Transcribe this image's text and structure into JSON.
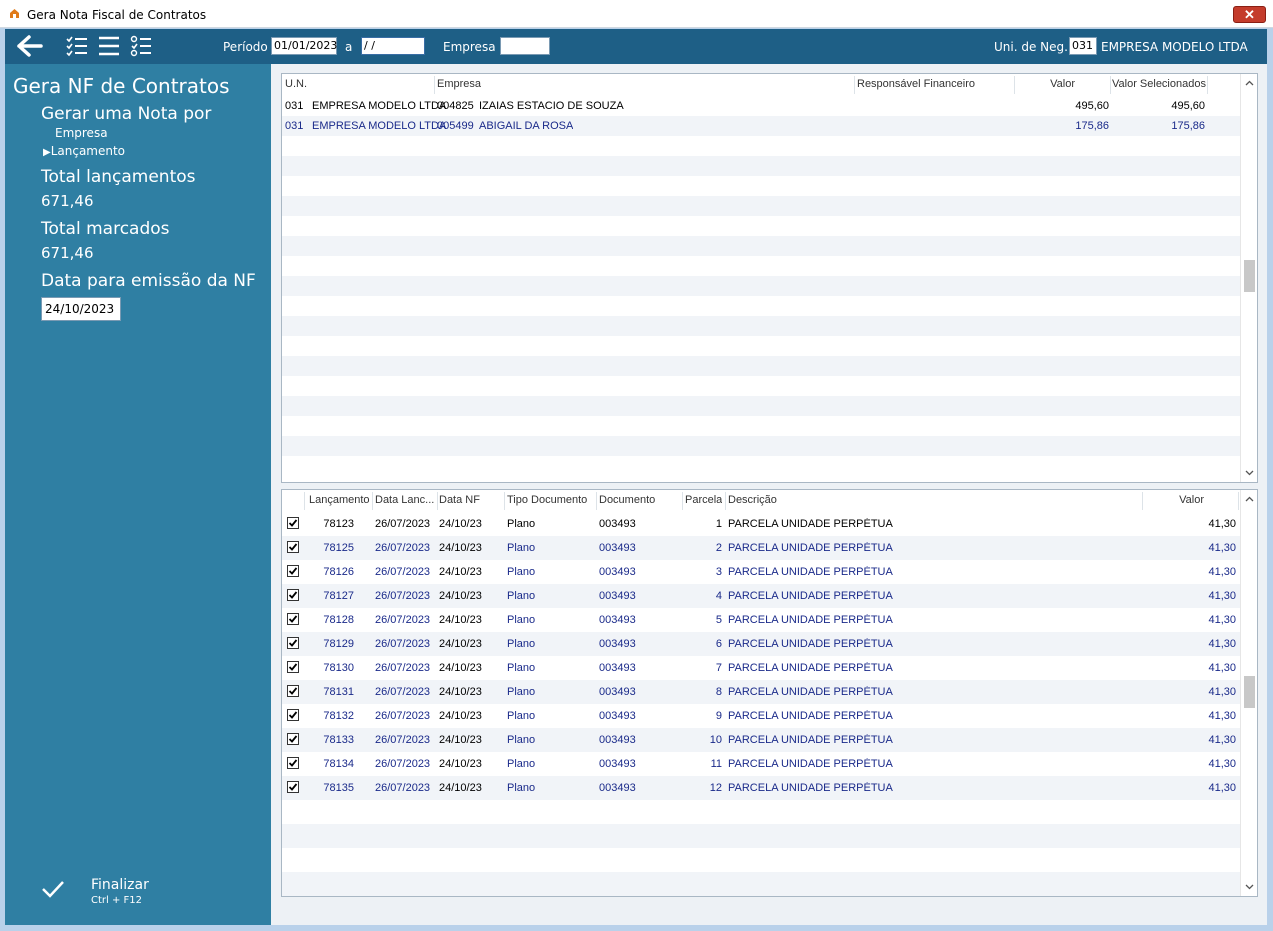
{
  "window": {
    "title": "Gera Nota Fiscal de Contratos",
    "close_glyph": "✕"
  },
  "toolbar": {
    "periodo_label": "Período",
    "periodo_start": "01/01/2023",
    "a_label": "a",
    "periodo_end": " / /",
    "empresa_label": "Empresa",
    "empresa_value": "",
    "uni_label": "Uni. de Neg.",
    "uni_code": "031",
    "uni_name": "EMPRESA MODELO LTDA"
  },
  "sidebar": {
    "heading": "Gera NF de Contratos",
    "gerar_label": "Gerar uma Nota por",
    "option_empresa": "Empresa",
    "option_lancamento": "Lançamento",
    "selected_marker": "▶",
    "total_lanc_label": "Total lançamentos",
    "total_lanc_value": "671,46",
    "total_marc_label": "Total marcados",
    "total_marc_value": "671,46",
    "data_emissao_label": "Data para emissão da NF",
    "data_emissao_value": "24/10/2023",
    "finalizar_label": "Finalizar",
    "finalizar_shortcut": "Ctrl + F12"
  },
  "grid_empresas": {
    "headers": [
      "U.N.",
      "Empresa",
      "Responsável Financeiro",
      "Valor",
      "Valor Selecionados"
    ],
    "rows": [
      {
        "un": "031",
        "un_name": "EMPRESA MODELO LTDA",
        "code": "004825",
        "name": "IZAIAS ESTACIO DE SOUZA",
        "resp": "",
        "valor": "495,60",
        "valor_sel": "495,60"
      },
      {
        "un": "031",
        "un_name": "EMPRESA MODELO LTDA",
        "code": "005499",
        "name": "ABIGAIL DA ROSA",
        "resp": "",
        "valor": "175,86",
        "valor_sel": "175,86"
      }
    ]
  },
  "grid_lancamentos": {
    "headers": [
      "Lançamento",
      "Data Lanc...",
      "Data NF",
      "Tipo Documento",
      "Documento",
      "Parcela",
      "Descrição",
      "Valor"
    ],
    "rows": [
      {
        "checked": true,
        "lanc": "78123",
        "data_lanc": "26/07/2023",
        "data_nf": "24/10/23",
        "tipo": "Plano",
        "doc": "003493",
        "parcela": "1",
        "desc": "PARCELA UNIDADE PERPÉTUA",
        "valor": "41,30"
      },
      {
        "checked": true,
        "lanc": "78125",
        "data_lanc": "26/07/2023",
        "data_nf": "24/10/23",
        "tipo": "Plano",
        "doc": "003493",
        "parcela": "2",
        "desc": "PARCELA UNIDADE PERPÉTUA",
        "valor": "41,30"
      },
      {
        "checked": true,
        "lanc": "78126",
        "data_lanc": "26/07/2023",
        "data_nf": "24/10/23",
        "tipo": "Plano",
        "doc": "003493",
        "parcela": "3",
        "desc": "PARCELA UNIDADE PERPÉTUA",
        "valor": "41,30"
      },
      {
        "checked": true,
        "lanc": "78127",
        "data_lanc": "26/07/2023",
        "data_nf": "24/10/23",
        "tipo": "Plano",
        "doc": "003493",
        "parcela": "4",
        "desc": "PARCELA UNIDADE PERPÉTUA",
        "valor": "41,30"
      },
      {
        "checked": true,
        "lanc": "78128",
        "data_lanc": "26/07/2023",
        "data_nf": "24/10/23",
        "tipo": "Plano",
        "doc": "003493",
        "parcela": "5",
        "desc": "PARCELA UNIDADE PERPÉTUA",
        "valor": "41,30"
      },
      {
        "checked": true,
        "lanc": "78129",
        "data_lanc": "26/07/2023",
        "data_nf": "24/10/23",
        "tipo": "Plano",
        "doc": "003493",
        "parcela": "6",
        "desc": "PARCELA UNIDADE PERPÉTUA",
        "valor": "41,30"
      },
      {
        "checked": true,
        "lanc": "78130",
        "data_lanc": "26/07/2023",
        "data_nf": "24/10/23",
        "tipo": "Plano",
        "doc": "003493",
        "parcela": "7",
        "desc": "PARCELA UNIDADE PERPÉTUA",
        "valor": "41,30"
      },
      {
        "checked": true,
        "lanc": "78131",
        "data_lanc": "26/07/2023",
        "data_nf": "24/10/23",
        "tipo": "Plano",
        "doc": "003493",
        "parcela": "8",
        "desc": "PARCELA UNIDADE PERPÉTUA",
        "valor": "41,30"
      },
      {
        "checked": true,
        "lanc": "78132",
        "data_lanc": "26/07/2023",
        "data_nf": "24/10/23",
        "tipo": "Plano",
        "doc": "003493",
        "parcela": "9",
        "desc": "PARCELA UNIDADE PERPÉTUA",
        "valor": "41,30"
      },
      {
        "checked": true,
        "lanc": "78133",
        "data_lanc": "26/07/2023",
        "data_nf": "24/10/23",
        "tipo": "Plano",
        "doc": "003493",
        "parcela": "10",
        "desc": "PARCELA UNIDADE PERPÉTUA",
        "valor": "41,30"
      },
      {
        "checked": true,
        "lanc": "78134",
        "data_lanc": "26/07/2023",
        "data_nf": "24/10/23",
        "tipo": "Plano",
        "doc": "003493",
        "parcela": "11",
        "desc": "PARCELA UNIDADE PERPÉTUA",
        "valor": "41,30"
      },
      {
        "checked": true,
        "lanc": "78135",
        "data_lanc": "26/07/2023",
        "data_nf": "24/10/23",
        "tipo": "Plano",
        "doc": "003493",
        "parcela": "12",
        "desc": "PARCELA UNIDADE PERPÉTUA",
        "valor": "41,30"
      }
    ]
  },
  "colors": {
    "toolbar": "#1e5f86",
    "sidebar": "#2f7fa3",
    "selected_text": "#1a2a8a",
    "stripe": "#f1f4f8"
  }
}
